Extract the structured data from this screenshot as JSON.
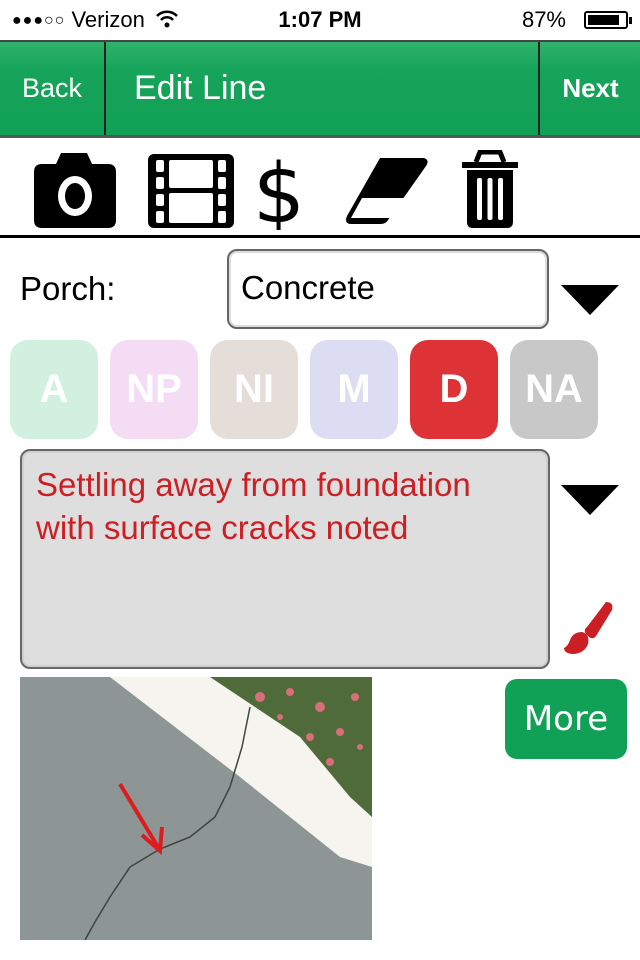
{
  "status_bar": {
    "signal": "●●●○○",
    "carrier": "Verizon",
    "time": "1:07 PM",
    "battery_percent": "87%",
    "battery_level": 0.87
  },
  "nav": {
    "back_label": "Back",
    "title": "Edit Line",
    "next_label": "Next",
    "color": "#11a156"
  },
  "toolbar": {
    "icons": [
      "camera-icon",
      "film-icon",
      "dollar-icon",
      "eraser-icon",
      "trash-icon"
    ]
  },
  "form": {
    "field_label": "Porch:",
    "field_value": "Concrete",
    "ratings": [
      {
        "label": "A",
        "color": "#d1f0e0",
        "selected": false
      },
      {
        "label": "NP",
        "color": "#f5dcf5",
        "selected": false
      },
      {
        "label": "NI",
        "color": "#e5ddd8",
        "selected": false
      },
      {
        "label": "M",
        "color": "#dcdcf3",
        "selected": false
      },
      {
        "label": "D",
        "color": "#dd3337",
        "selected": true
      },
      {
        "label": "NA",
        "color": "#c8c8c8",
        "selected": false
      }
    ],
    "comment": "Settling away from foundation with surface cracks noted",
    "comment_color": "#cc1f24"
  },
  "photo": {
    "description": "Concrete porch slab with crack and red arrow annotation"
  },
  "more_label": "More"
}
